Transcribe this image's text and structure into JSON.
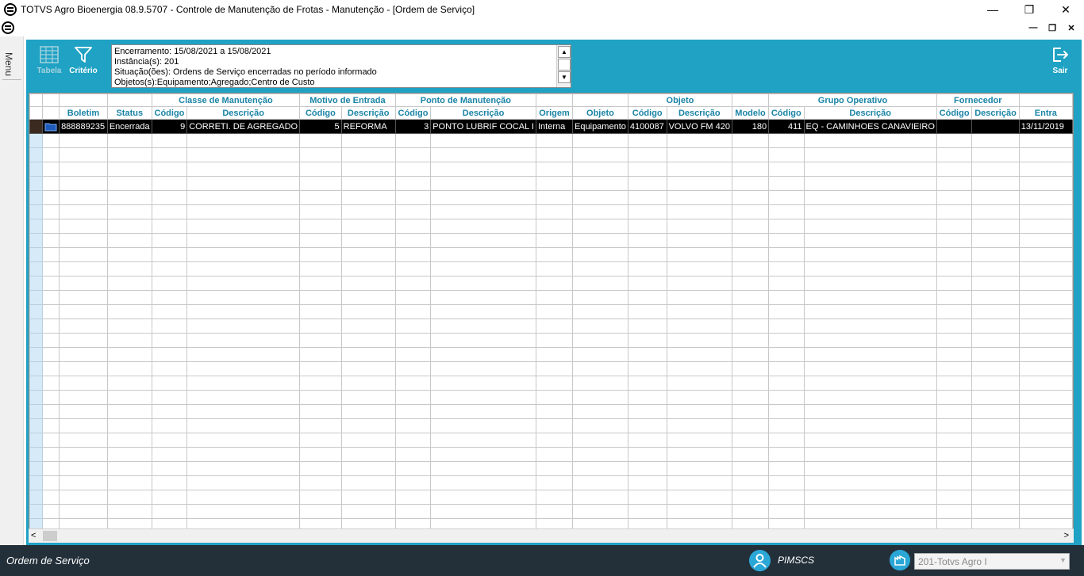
{
  "window": {
    "title": "TOTVS Agro Bioenergia 08.9.5707 - Controle de Manutenção de Frotas - Manutenção - [Ordem de Serviço]",
    "min": "—",
    "restore": "❐",
    "close": "✕"
  },
  "mdi": {
    "min": "—",
    "restore": "❐",
    "close": "✕"
  },
  "menu": {
    "label": "Menu"
  },
  "toolbar": {
    "tabela": "Tabela",
    "criterio": "Critério",
    "sair": "Sair"
  },
  "criteria": {
    "line1": "Encerramento: 15/08/2021 a 15/08/2021",
    "line2": "Instância(s): 201",
    "line3": "Situação(ões): Ordens de Serviço encerradas no período informado",
    "line4": "Objetos(s):Equipamento;Agregado;Centro de Custo"
  },
  "grid": {
    "group_headers": {
      "classe": "Classe de Manutenção",
      "motivo": "Motivo de Entrada",
      "ponto": "Ponto de Manutenção",
      "objeto": "Objeto",
      "grupo": "Grupo Operativo",
      "fornecedor": "Fornecedor"
    },
    "col_headers": {
      "boletim": "Boletim",
      "status": "Status",
      "classe_cod": "Código",
      "classe_desc": "Descrição",
      "motivo_cod": "Código",
      "motivo_desc": "Descrição",
      "ponto_cod": "Código",
      "ponto_desc": "Descrição",
      "origem": "Origem",
      "objeto": "Objeto",
      "obj_cod": "Código",
      "obj_desc": "Descrição",
      "modelo": "Modelo",
      "grupo_cod": "Código",
      "grupo_desc": "Descrição",
      "forn_cod": "Código",
      "forn_desc": "Descrição",
      "entrada": "Entra"
    },
    "row1": {
      "boletim": "888889235",
      "status": "Encerrada",
      "classe_cod": "9",
      "classe_desc": "CORRETI. DE AGREGADO",
      "motivo_cod": "5",
      "motivo_desc": "REFORMA",
      "ponto_cod": "3",
      "ponto_desc": "PONTO LUBRIF COCAL I",
      "origem": "Interna",
      "objeto": "Equipamento",
      "obj_cod": "4100087",
      "obj_desc": "VOLVO FM 420",
      "modelo": "180",
      "grupo_cod": "411",
      "grupo_desc": "EQ - CAMINHOES CANAVIEIRO",
      "forn_cod": "",
      "forn_desc": "",
      "entrada": "13/11/2019"
    }
  },
  "status": {
    "form_name": "Ordem de Serviço",
    "user": "PIMSCS",
    "instance": "201-Totvs Agro I"
  }
}
